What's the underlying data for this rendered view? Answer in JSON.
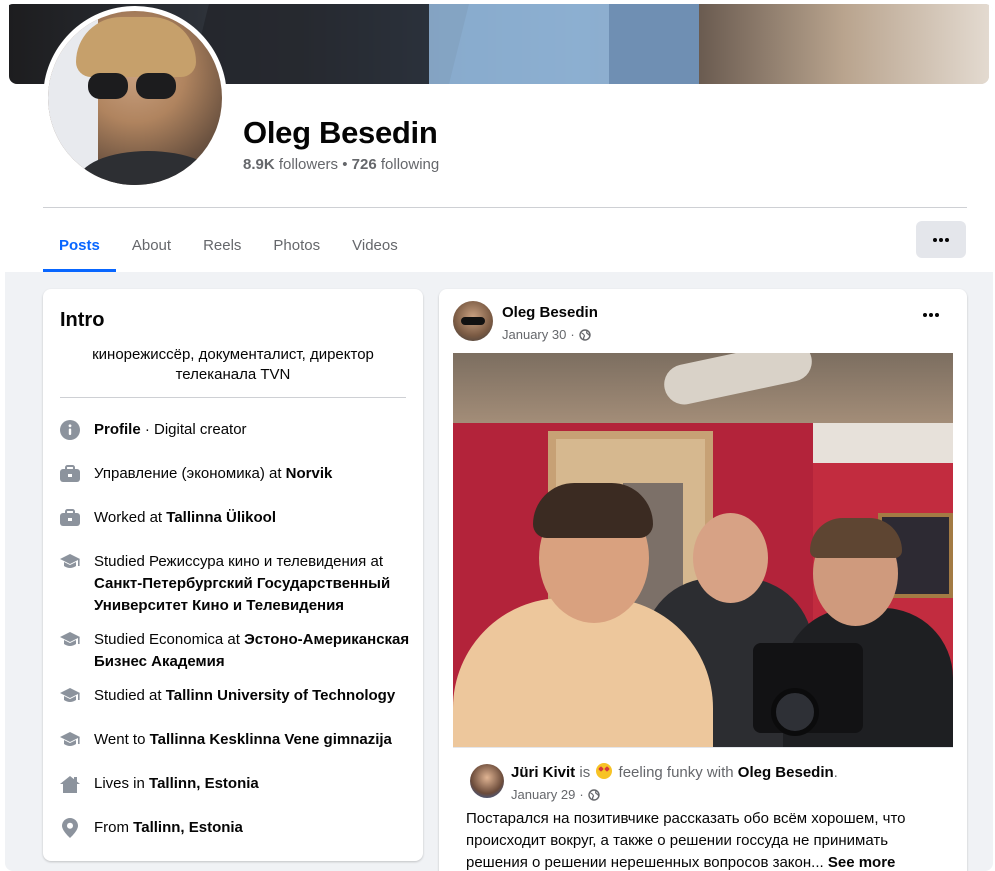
{
  "profile": {
    "name": "Oleg Besedin",
    "followers": "8.9K",
    "followers_label": "followers",
    "separator": "•",
    "following": "726",
    "following_label": "following"
  },
  "tabs": [
    {
      "label": "Posts",
      "active": true
    },
    {
      "label": "About"
    },
    {
      "label": "Reels"
    },
    {
      "label": "Photos"
    },
    {
      "label": "Videos"
    }
  ],
  "intro": {
    "title": "Intro",
    "bio": "кинорежиссёр, документалист, директор телеканала TVN",
    "items": [
      {
        "icon": "info-icon",
        "pre": "",
        "bold": "Profile",
        "post": " · Digital creator"
      },
      {
        "icon": "work-icon",
        "pre": "Управление (экономика) at ",
        "bold": "Norvik",
        "post": ""
      },
      {
        "icon": "work-icon",
        "pre": "Worked at ",
        "bold": "Tallinna Ülikool",
        "post": ""
      },
      {
        "icon": "education-icon",
        "pre": "Studied Режиссура кино и телевидения at ",
        "bold": "Санкт-Петербургский Государственный Университет Кино и Телевидения",
        "post": ""
      },
      {
        "icon": "education-icon",
        "pre": "Studied Economica at ",
        "bold": "Эстоно-Американская Бизнес Академия",
        "post": ""
      },
      {
        "icon": "education-icon",
        "pre": "Studied at ",
        "bold": "Tallinn University of Technology",
        "post": ""
      },
      {
        "icon": "education-icon",
        "pre": "Went to ",
        "bold": "Tallinna Kesklinna Vene gimnazija",
        "post": ""
      },
      {
        "icon": "home-icon",
        "pre": "Lives in ",
        "bold": "Tallinn, Estonia",
        "post": ""
      },
      {
        "icon": "location-pin-icon",
        "pre": "From ",
        "bold": "Tallinn, Estonia",
        "post": ""
      }
    ]
  },
  "post": {
    "author": "Oleg Besedin",
    "date": "January 30",
    "dot": "·",
    "shared": {
      "author": "Jüri Kivit",
      "is_text": "is",
      "feeling": "feeling funky with",
      "with": "Oleg Besedin",
      "period": ".",
      "date": "January 29",
      "dot": "·",
      "text": "Постарался на позитивчике рассказать обо всём хорошем, что происходит вокруг, а также о решении госсуда не принимать решения о решении нерешенных вопросов закон...",
      "see_more": "See more"
    }
  },
  "colors": {
    "accent": "#0866ff",
    "secondary_text": "#65676b",
    "background": "#f0f2f5",
    "icon": "#8c939d"
  }
}
